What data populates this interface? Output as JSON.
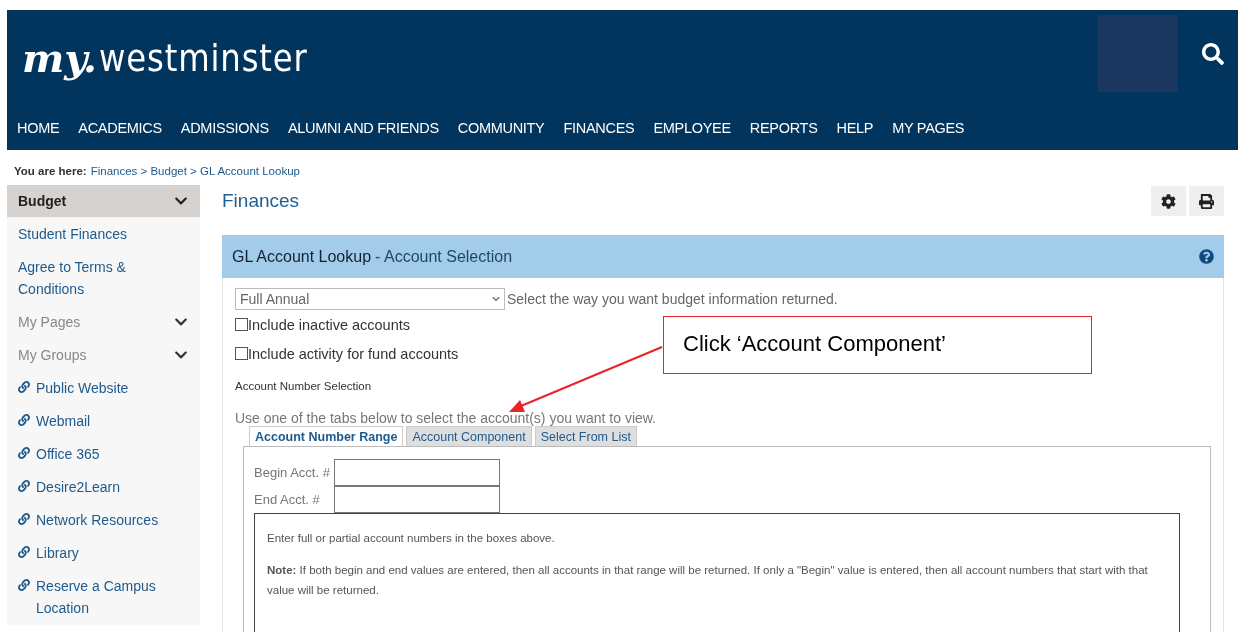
{
  "header": {
    "logo": {
      "prefix": "my.",
      "name": "westminster"
    },
    "nav": [
      "HOME",
      "ACADEMICS",
      "ADMISSIONS",
      "ALUMNI AND FRIENDS",
      "COMMUNITY",
      "FINANCES",
      "EMPLOYEE",
      "REPORTS",
      "HELP",
      "MY PAGES"
    ]
  },
  "breadcrumb": {
    "label": "You are here:",
    "path": "Finances > Budget > GL Account Lookup"
  },
  "sidebar": {
    "title": "Budget",
    "expanded": false,
    "items": [
      {
        "kind": "link",
        "label": "Student Finances"
      },
      {
        "kind": "link",
        "label": "Agree to Terms & Conditions"
      },
      {
        "kind": "group",
        "label": "My Pages",
        "expanded": false
      },
      {
        "kind": "group",
        "label": "My Groups",
        "expanded": false
      },
      {
        "kind": "external",
        "label": "Public Website"
      },
      {
        "kind": "external",
        "label": "Webmail"
      },
      {
        "kind": "external",
        "label": "Office 365"
      },
      {
        "kind": "external",
        "label": "Desire2Learn"
      },
      {
        "kind": "external",
        "label": "Network Resources"
      },
      {
        "kind": "external",
        "label": "Library"
      },
      {
        "kind": "external",
        "label": "Reserve a Campus Location"
      }
    ]
  },
  "page_title": "Finances",
  "panel": {
    "title": "GL Account Lookup",
    "subtitle": "- Account Selection",
    "period": {
      "value": "Full Annual",
      "hint": "Select the way you want budget information returned."
    },
    "options": [
      {
        "label": "Include inactive accounts",
        "checked": false
      },
      {
        "label": "Include activity for fund accounts",
        "checked": false
      }
    ],
    "section_label": "Account Number Selection",
    "instructions": "Use one of the tabs below to select the account(s) you want to view.",
    "tabs": [
      {
        "label": "Account Number Range",
        "selected": true
      },
      {
        "label": "Account Component",
        "selected": false
      },
      {
        "label": "Select From List",
        "selected": false
      }
    ],
    "fields": [
      {
        "label": "Begin Acct. #"
      },
      {
        "label": "End Acct. #"
      }
    ],
    "help_text": "Enter full or partial account numbers in the boxes above.",
    "note": "**Note:** If both begin and end values are entered, then all accounts in that range will be returned. If only a \"Begin\" value is entered, then all account numbers that start with that value will be returned."
  },
  "annotation": {
    "text": "Click ‘Account Component’"
  }
}
